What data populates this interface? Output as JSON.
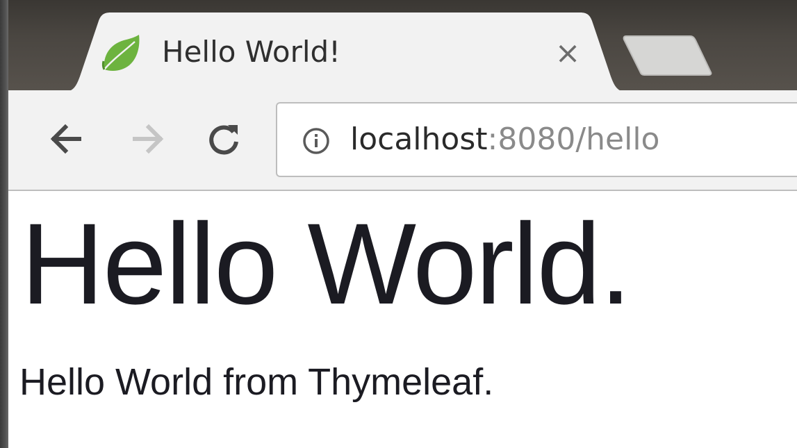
{
  "tab": {
    "title": "Hello World!",
    "favicon": "spring-leaf-icon",
    "close_glyph": "×"
  },
  "toolbar": {
    "back_icon": "arrow-left-icon",
    "forward_icon": "arrow-right-icon",
    "reload_icon": "reload-icon",
    "forward_enabled": false
  },
  "address_bar": {
    "info_icon": "info-icon",
    "url_host": "localhost",
    "url_rest": ":8080/hello"
  },
  "page": {
    "heading": "Hello World.",
    "paragraph": "Hello World from Thymeleaf."
  },
  "colors": {
    "tabstrip": "#4a4641",
    "tab_active": "#f2f2f2",
    "favicon_green": "#6db33f",
    "text": "#1b1b22",
    "url_muted": "#8a8a8a",
    "icon_disabled": "#c5c5c5"
  }
}
